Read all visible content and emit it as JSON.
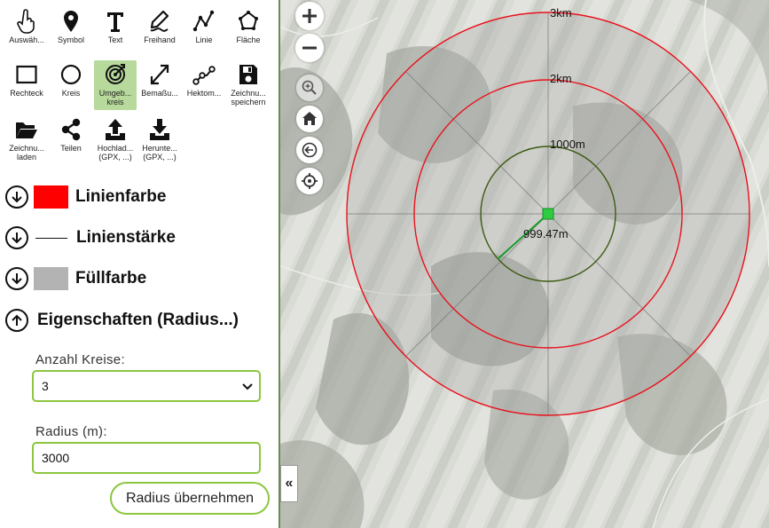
{
  "tools": [
    {
      "id": "select",
      "label": "Auswäh...",
      "icon": "pointer-hand-icon"
    },
    {
      "id": "symbol",
      "label": "Symbol",
      "icon": "map-pin-icon"
    },
    {
      "id": "text",
      "label": "Text",
      "icon": "text-t-icon"
    },
    {
      "id": "freehand",
      "label": "Freihand",
      "icon": "freehand-pen-icon"
    },
    {
      "id": "line",
      "label": "Linie",
      "icon": "polyline-icon"
    },
    {
      "id": "area",
      "label": "Fläche",
      "icon": "polygon-icon"
    },
    {
      "id": "rectangle",
      "label": "Rechteck",
      "icon": "rectangle-icon"
    },
    {
      "id": "circle",
      "label": "Kreis",
      "icon": "circle-icon"
    },
    {
      "id": "surrounding",
      "label": "Umgeb...\nkreis",
      "icon": "target-icon",
      "active": true
    },
    {
      "id": "measure",
      "label": "Bemaßu...",
      "icon": "diagonal-arrow-icon"
    },
    {
      "id": "hectometer",
      "label": "Hektom...",
      "icon": "node-line-icon"
    },
    {
      "id": "save",
      "label": "Zeichnu...\nspeichern",
      "icon": "floppy-disk-icon"
    },
    {
      "id": "load",
      "label": "Zeichnu...\nladen",
      "icon": "folder-open-icon"
    },
    {
      "id": "share",
      "label": "Teilen",
      "icon": "share-icon"
    },
    {
      "id": "upload",
      "label": "Hochlad...\n(GPX, ...)",
      "icon": "upload-icon"
    },
    {
      "id": "download",
      "label": "Herunte...\n(GPX, ...)",
      "icon": "download-icon"
    }
  ],
  "properties": {
    "line_color": {
      "label": "Linienfarbe",
      "color": "#ff0000"
    },
    "line_width": {
      "label": "Linienstärke"
    },
    "fill_color": {
      "label": "Füllfarbe",
      "color": "#b3b3b3"
    },
    "settings": {
      "label": "Eigenschaften (Radius...)"
    }
  },
  "form": {
    "count_label": "Anzahl Kreise:",
    "count_value": "3",
    "radius_label": "Radius (m):",
    "radius_value": "3000",
    "apply_label": "Radius übernehmen"
  },
  "collapse_label": "«",
  "map": {
    "controls": [
      "zoom-in-icon",
      "zoom-out-icon",
      "zoom-magnifier-icon",
      "home-icon",
      "back-icon",
      "locate-icon"
    ],
    "ring_labels": [
      "3km",
      "2km",
      "1000m"
    ],
    "measure_label": "999.47m",
    "colors": {
      "outer_rings": "#e8121c",
      "inner_ring": "#3d5a10",
      "center": "#2ecc40",
      "measure_line": "#1a9a2a"
    }
  }
}
